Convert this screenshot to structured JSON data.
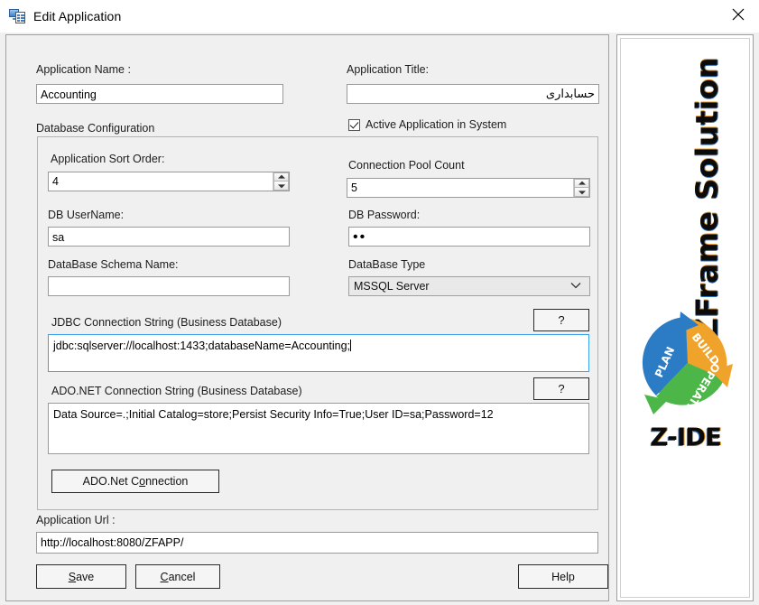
{
  "window": {
    "title": "Edit Application",
    "icon": "application-form-icon",
    "close_label": "✕"
  },
  "form": {
    "application_name": {
      "label": "Application  Name :",
      "value": "Accounting"
    },
    "application_title": {
      "label": "Application Title:",
      "value": "حسابداری"
    },
    "active_application": {
      "label": "Active Application in System",
      "checked": true
    },
    "database_configuration": {
      "legend": "Database Configuration",
      "application_sort_order": {
        "label": "Application Sort Order:",
        "value": "4"
      },
      "connection_pool_count": {
        "label": "Connection Pool Count",
        "value": "5"
      },
      "db_username": {
        "label": "DB UserName:",
        "value": "sa"
      },
      "db_password": {
        "label": "DB Password:",
        "value": "••"
      },
      "database_schema_name": {
        "label": "DataBase Schema Name:",
        "value": ""
      },
      "database_type": {
        "label": "DataBase Type",
        "value": "MSSQL Server",
        "options": [
          "MSSQL Server"
        ]
      },
      "jdbc_connection_string": {
        "label": "JDBC Connection String (Business Database)",
        "value": "jdbc:sqlserver://localhost:1433;databaseName=Accounting;",
        "help_label": "?"
      },
      "adonet_connection_string": {
        "label": "ADO.NET Connection String (Business Database)",
        "value": "Data Source=.;Initial Catalog=store;Persist Security Info=True;User ID=sa;Password=12",
        "help_label": "?"
      },
      "adonet_connection_button": {
        "prefix": "ADO.Net C",
        "mnemonic": "o",
        "suffix": "nnection"
      }
    },
    "application_url": {
      "label": "Application Url :",
      "value": "http://localhost:8080/ZFAPP/"
    }
  },
  "footer": {
    "save": {
      "mnemonic": "S",
      "rest": "ave"
    },
    "cancel": {
      "mnemonic": "C",
      "rest": "ancel"
    },
    "help": {
      "label": "Help"
    }
  },
  "branding": {
    "vertical_title": "ZFrame Solution",
    "product": "Z-IDE",
    "cycle": {
      "plan": "PLAN",
      "build": "BUILD",
      "operate": "OPERATE",
      "plan_color": "#2b7cc4",
      "build_color": "#f0a32a",
      "operate_color": "#4cb648"
    }
  }
}
